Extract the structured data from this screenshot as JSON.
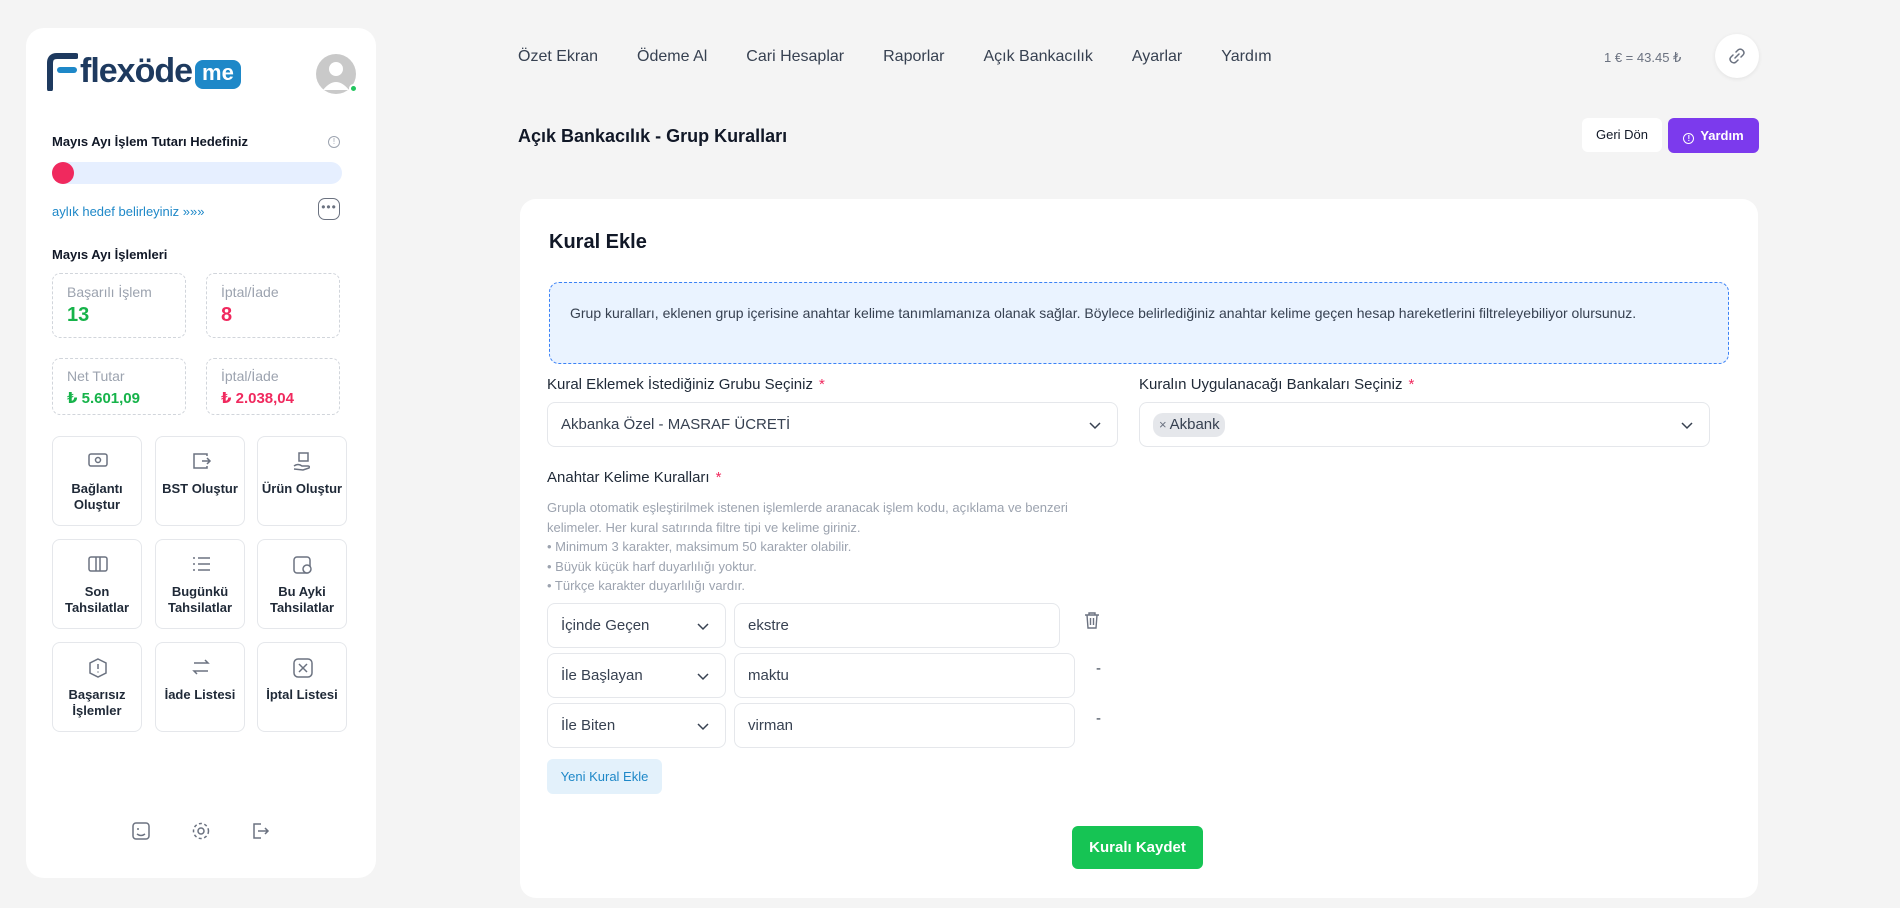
{
  "brand": {
    "name": "flexöde",
    "suffix": "me"
  },
  "sidebar": {
    "goal_title": "Mayıs Ayı İşlem Tutarı Hedefiniz",
    "goal_progress_percent": 0,
    "goal_link": "aylık hedef belirleyiniz »»»",
    "month_title": "Mayıs Ayı İşlemleri",
    "stats": [
      {
        "label": "Başarılı İşlem",
        "value": "13"
      },
      {
        "label": "İptal/İade",
        "value": "8"
      },
      {
        "label": "Net Tutar",
        "value": "₺ 5.601,09"
      },
      {
        "label": "İptal/İade",
        "value": "₺ 2.038,04"
      }
    ],
    "tiles": [
      {
        "label": "Bağlantı Oluştur",
        "icon": "money-icon"
      },
      {
        "label": "BST Oluştur",
        "icon": "wallet-icon"
      },
      {
        "label": "Ürün Oluştur",
        "icon": "hand-box-icon"
      },
      {
        "label": "Son Tahsilatlar",
        "icon": "card-icon"
      },
      {
        "label": "Bugünkü Tahsilatlar",
        "icon": "list-icon"
      },
      {
        "label": "Bu Ayki Tahsilatlar",
        "icon": "calendar-icon"
      },
      {
        "label": "Başarısız İşlemler",
        "icon": "alert-icon"
      },
      {
        "label": "İade Listesi",
        "icon": "refund-icon"
      },
      {
        "label": "İptal Listesi",
        "icon": "cancel-icon"
      }
    ]
  },
  "nav": [
    "Özet Ekran",
    "Ödeme Al",
    "Cari Hesaplar",
    "Raporlar",
    "Açık Bankacılık",
    "Ayarlar",
    "Yardım"
  ],
  "rate": "1 € = 43.45 ₺",
  "page": {
    "title": "Açık Bankacılık - Grup Kuralları",
    "back_label": "Geri Dön",
    "help_label": "Yardım"
  },
  "card": {
    "title": "Kural Ekle",
    "info": "Grup kuralları, eklenen grup içerisine anahtar kelime tanımlamanıza olanak sağlar. Böylece belirlediğiniz anahtar kelime geçen hesap hareketlerini filtreleyebiliyor olursunuz.",
    "group_label": "Kural Eklemek İstediğiniz Grubu Seçiniz",
    "group_value": "Akbanka Özel - MASRAF ÜCRETİ",
    "bank_label": "Kuralın Uygulanacağı Bankaları Seçiniz",
    "bank_chip": "Akbank",
    "keyword_label": "Anahtar Kelime Kuralları",
    "help_lines": [
      "Grupla otomatik eşleştirilmek istenen işlemlerde aranacak işlem kodu, açıklama ve benzeri kelimeler. Her kural satırında filtre tipi ve kelime giriniz.",
      "• Minimum 3 karakter, maksimum 50 karakter olabilir.",
      "• Büyük küçük harf duyarlılığı yoktur.",
      "• Türkçe karakter duyarlılığı vardır."
    ],
    "rules": [
      {
        "type": "İçinde Geçen",
        "value": "ekstre"
      },
      {
        "type": "İle Başlayan",
        "value": "maktu",
        "action": "-"
      },
      {
        "type": "İle Biten",
        "value": "virman",
        "action": "-"
      }
    ],
    "add_rule_label": "Yeni Kural Ekle",
    "save_label": "Kuralı Kaydet",
    "required_mark": "*"
  }
}
